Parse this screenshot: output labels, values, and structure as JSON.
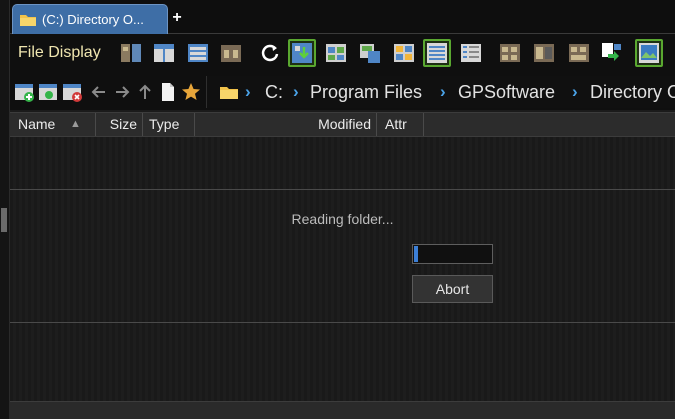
{
  "tab": {
    "title": "(C:) Directory O...",
    "add_symbol": "+"
  },
  "toolbar": {
    "label": "File Display",
    "label_color": "#f0e6b0",
    "accent_color": "#5aa830"
  },
  "path": {
    "crumbs": [
      "C:",
      "Program Files",
      "GPSoftware",
      "Directory O"
    ],
    "separator": "›",
    "separator_color": "#4aa3e8"
  },
  "columns": {
    "name": "Name",
    "sort_indicator": "▲",
    "size": "Size",
    "type": "Type",
    "modified": "Modified",
    "attr": "Attr"
  },
  "loading": {
    "message": "Reading folder...",
    "progress": 0.05,
    "abort_label": "Abort",
    "progress_color": "#3c7fd6"
  },
  "icons": [
    "folder-icon",
    "layout-icons",
    "refresh-icon",
    "back-arrow-icon",
    "forward-arrow-icon",
    "up-arrow-icon",
    "document-icon",
    "star-icon"
  ]
}
